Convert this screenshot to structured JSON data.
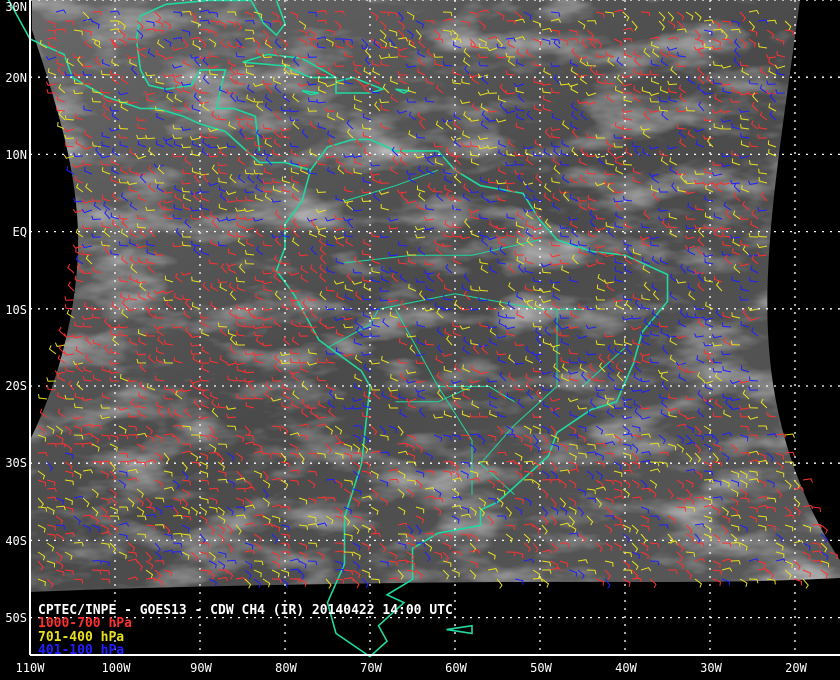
{
  "title": "CPTEC/INPE - GOES13 - CDW CH4 (IR) 20140422 14:00 UTC",
  "legend": [
    {
      "label": "1000-700 hPa",
      "color": "#ff3030"
    },
    {
      "label": "701-400 hPa",
      "color": "#e8e020"
    },
    {
      "label": "401-100 hPa",
      "color": "#2020ff"
    }
  ],
  "lat_labels": [
    "30N",
    "20N",
    "10N",
    "EQ",
    "10S",
    "20S",
    "30S",
    "40S",
    "50S"
  ],
  "lon_labels": [
    "110W",
    "100W",
    "90W",
    "80W",
    "70W",
    "60W",
    "50W",
    "40W",
    "30W",
    "20W"
  ],
  "colors": {
    "coast": "#20d8a0",
    "grid": "#ffffff"
  }
}
